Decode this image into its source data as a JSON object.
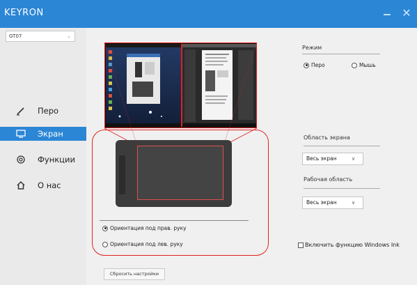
{
  "window": {
    "title": "KEYRON",
    "minimize_label": "—",
    "close_label": "✕"
  },
  "sidebar": {
    "device_select": "GT07",
    "items": [
      {
        "label": "Перо",
        "icon": "pen-icon",
        "active": false
      },
      {
        "label": "Экран",
        "icon": "screen-icon",
        "active": true
      },
      {
        "label": "Функции",
        "icon": "functions-icon",
        "active": false
      },
      {
        "label": "О нас",
        "icon": "home-icon",
        "active": false
      }
    ]
  },
  "main": {
    "orientation": {
      "right_hand": "Ориентация под прав. руку",
      "left_hand": "Ориентация под лев. руку",
      "selected": "right_hand"
    },
    "reset_label": "Сбросить настройки"
  },
  "right_panel": {
    "mode": {
      "label": "Режим",
      "options": [
        "Перо",
        "Мышь"
      ],
      "selected": "Перо"
    },
    "screen_area": {
      "label": "Область экрана",
      "value": "Весь экран"
    },
    "work_area": {
      "label": "Рабочая область",
      "value": "Весь экран"
    },
    "windows_ink_label": "Включить функцию Windows Ink",
    "windows_ink_checked": false
  },
  "colors": {
    "accent": "#2b86d6",
    "highlight": "#e0211e"
  }
}
